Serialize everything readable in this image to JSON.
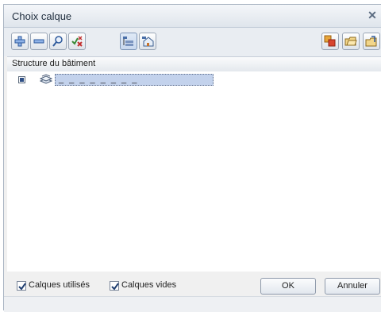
{
  "window": {
    "title": "Choix calque"
  },
  "toolbar": {
    "left_buttons": [
      "add-icon",
      "remove-icon",
      "search-icon",
      "check-toggle-icon",
      "layer-structure-icon",
      "building-icon"
    ],
    "right_buttons": [
      "copy-layers-icon",
      "open-folder-icon",
      "export-icon"
    ]
  },
  "tree": {
    "header": "Structure du bâtiment",
    "node_label": "_ _ _ _ _ _ _ _"
  },
  "footer": {
    "used_layers_label": "Calques utilisés",
    "used_layers_checked": true,
    "empty_layers_label": "Calques vides",
    "empty_layers_checked": true,
    "ok_label": "OK",
    "cancel_label": "Annuler"
  },
  "colors": {
    "selection": "#c3d2ec",
    "accent": "#2e4f86"
  }
}
